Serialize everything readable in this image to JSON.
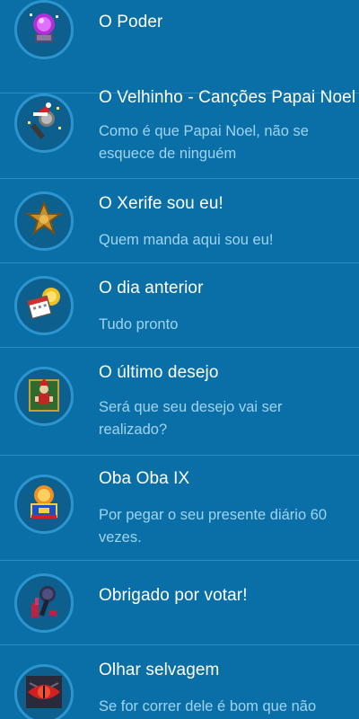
{
  "achievements": [
    {
      "title": "O Poder",
      "description": "",
      "icon": "power-orb-icon"
    },
    {
      "title": "O Velhinho - Canções Papai Noel",
      "description": "Como é que Papai Noel, não se esquece de ninguém",
      "icon": "santa-microphone-icon"
    },
    {
      "title": "O Xerife sou eu!",
      "description": "Quem manda aqui sou eu!",
      "icon": "sheriff-star-icon"
    },
    {
      "title": "O dia anterior",
      "description": "Tudo pronto",
      "icon": "calendar-sun-icon"
    },
    {
      "title": "O último desejo",
      "description": "Será que seu desejo vai ser realizado?",
      "icon": "genie-card-icon"
    },
    {
      "title": "Oba Oba IX",
      "description": "Por pegar o seu presente diário 60 vezes.",
      "icon": "gift-sun-icon"
    },
    {
      "title": "Obrigado por votar!",
      "description": "",
      "icon": "vote-microphone-icon"
    },
    {
      "title": "Olhar selvagem",
      "description": "Se for correr dele é bom que não",
      "icon": "wild-eye-icon"
    }
  ],
  "colors": {
    "background": "#0a6fa6",
    "divider": "#2a8cc4",
    "title": "#ffffff",
    "description": "#9fd4f2",
    "badge_ring": "#2b95d0"
  }
}
